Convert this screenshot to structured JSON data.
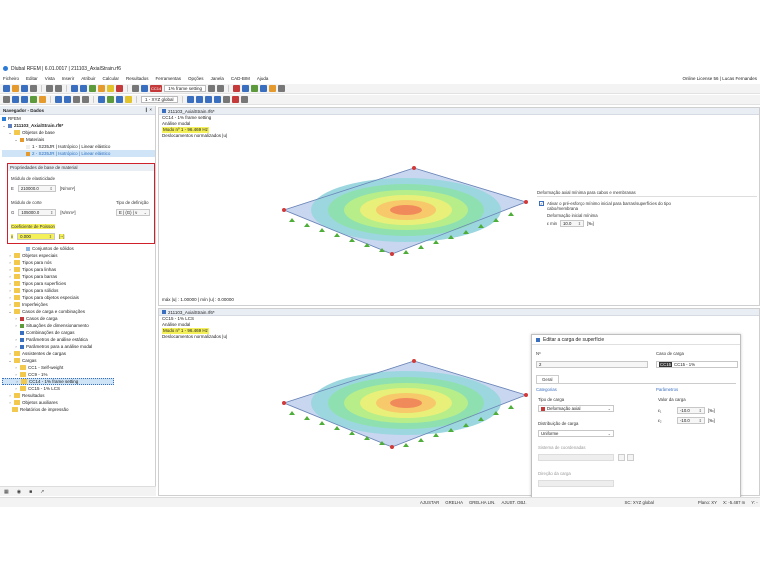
{
  "window": {
    "title": "Dlubal RFEM | 6.01.0017 | 211103_AxialStrain.rf6"
  },
  "menu": {
    "items": [
      "Ficheiro",
      "Editar",
      "Vista",
      "Inserir",
      "Atribuir",
      "Calcular",
      "Resultados",
      "Ferramentas",
      "Opções",
      "Janela",
      "CAD-BIM",
      "Ajuda"
    ],
    "license": "Online License 56 | Lucas Fernandes"
  },
  "toolbar": {
    "load_case_tag": "CC14",
    "load_case_label": "1% frame setting",
    "coord_system": "1 - XYZ global"
  },
  "navigator": {
    "title": "Navegador - Dados",
    "controls": "❙ ×",
    "root": "RFEM",
    "model": "211103_AxialStrain.rf6*",
    "base_objects": "Objetos de base",
    "materials": "Materiais",
    "material_1": "1 - S235JR | Isotrópico | Linear elástico",
    "material_2": "2 - S235JR | Isotrópico | Linear elástico",
    "items_mid": [
      "Conjuntos de superfícies",
      "Conjuntos de sólidos",
      "Objetos especiais",
      "Tipos para nós",
      "Tipos para linhas",
      "Tipos para barras",
      "Tipos para superfícies",
      "Tipos para sólidos",
      "Tipos para objetos especiais",
      "Imperfeições",
      "Casos de carga e combinações"
    ],
    "lc_items": [
      "Casos de carga",
      "Situações de dimensionamento",
      "Combinações de cargas",
      "Parâmetros de análise estática",
      "Parâmetros para a análise modal"
    ],
    "assistants": "Assistentes de cargas",
    "loads": "Cargas",
    "load_cases": [
      "CC1 - Self-weight",
      "CC9 - 1%",
      "CC14 - 1% frame setting",
      "CC15 - 1% LCS"
    ],
    "results": "Resultados",
    "aux_objects": "Objetos auxiliares",
    "print_reports": "Relatórios de impressão"
  },
  "material_props": {
    "title": "Propriedades de base de material",
    "elastic_label": "Módulo de elasticidade",
    "elastic_symbol": "E",
    "elastic_value": "210000.0",
    "elastic_unit": "[N/mm²]",
    "shear_label": "Módulo de corte",
    "shear_symbol": "G",
    "shear_value": "105000.0",
    "shear_unit": "[N/mm²]",
    "def_type_label": "Tipo de definição",
    "def_type_value": "E | (G) | ν",
    "poisson_label": "Coeficiente de Poisson",
    "poisson_symbol": "ν",
    "poisson_value": "0.000",
    "poisson_unit": "[--]"
  },
  "view_top": {
    "tab": "211103_AxialStrain.rf6*",
    "lc": "CC14 - 1% frame setting",
    "analysis": "Análise modal",
    "mode": "Modo nº 1 - 96.469 Hz",
    "disp": "Deslocamentos normalizados |u|",
    "minmax": "máx |u| : 1.00000 | mín |u| : 0.00000",
    "side_title": "Deformação axial mínima para cabos e membranas",
    "checkbox_label": "Ativar o pré-esforço mínimo inicial para barras/superfícies do tipo cabo/membrana",
    "strain_label": "Deformação inicial mínima",
    "strain_symbol": "ε min",
    "strain_value": "10.0",
    "strain_unit": "[‰]"
  },
  "view_bottom": {
    "tab": "211103_AxialStrain.rf6*",
    "lc": "CC15 - 1% LCS",
    "analysis": "Análise modal",
    "mode": "Modo nº 1 - 96.469 Hz",
    "disp": "Deslocamentos normalizados |u|"
  },
  "dialog": {
    "title": "Editar a carga de superfície",
    "no_label": "Nº",
    "no_value": "2",
    "lc_label": "Caso de carga",
    "lc_tag": "CC15",
    "lc_value": "CC15 - 1%",
    "tab_general": "Geral",
    "category_label": "Categorias",
    "load_type_label": "Tipo de carga",
    "load_type_value": "Deformação axial",
    "dist_label": "Distribuição de carga",
    "dist_value": "Uniforme",
    "coord_label": "Sistema de coordenadas",
    "dir_label": "Direção da carga",
    "params_label": "Parâmetros",
    "load_value_label": "Valor da carga",
    "e1_symbol": "ε₁",
    "e1_value": "-10.0",
    "e2_symbol": "ε₂",
    "e2_value": "-10.0",
    "unit": "[‰]"
  },
  "status": {
    "items": [
      "AJUSTAR",
      "GRELHA",
      "GRELHA LIN.",
      "AJUST. OBJ."
    ],
    "cs": "SC: XYZ global",
    "plane": "Plano: XY",
    "x": "X: -5.487 m",
    "y": "Y: -"
  }
}
